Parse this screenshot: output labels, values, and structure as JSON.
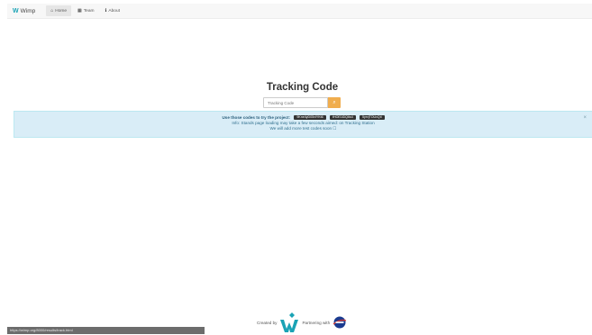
{
  "navbar": {
    "brand": "Wimp",
    "items": [
      {
        "icon": "home-icon",
        "glyph": "⌂",
        "label": "Home"
      },
      {
        "icon": "users-icon",
        "glyph": "▦",
        "label": "Team"
      },
      {
        "icon": "info-icon",
        "glyph": "ℹ",
        "label": "About"
      }
    ]
  },
  "main": {
    "title": "Tracking Code",
    "search": {
      "placeholder": "Tracking Code",
      "button_icon": "search-icon",
      "button_glyph": "⌕"
    }
  },
  "alert": {
    "line1": "Use those codes to try the project:",
    "codes": [
      "9Kne4yD05vIYKt6",
      "tHOE1lDQ6s4",
      "5yrvjTOUvQtl"
    ],
    "line2": "Info: Stands page loading may take a few seconds aimed: on Tracking Station",
    "line3": "We will add more test codes soon ☐",
    "close": "×"
  },
  "footer": {
    "created_by": "Created by",
    "and": "Partnering with"
  },
  "statusbar": {
    "text": "https://wimp.org/8000/results/track.html"
  },
  "colors": {
    "accent_orange": "#f0ad4e",
    "alert_bg": "#d9edf7",
    "brand_teal": "#1aa3b5",
    "nasa_blue": "#1b3b8f"
  }
}
